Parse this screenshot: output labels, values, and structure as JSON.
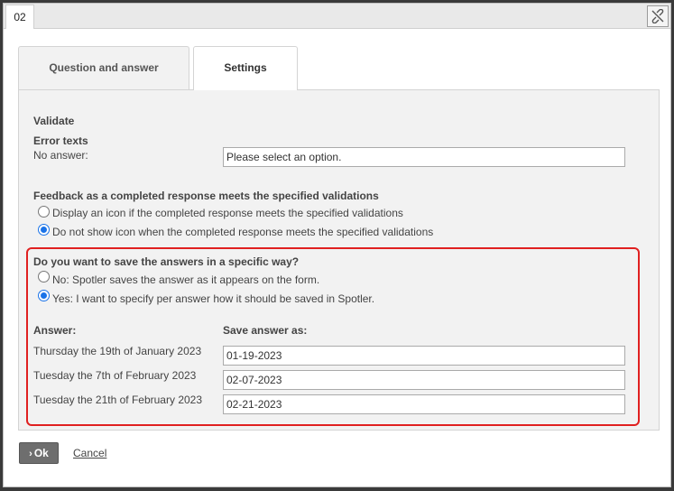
{
  "window": {
    "tab_label": "02"
  },
  "tabs": [
    {
      "label": "Question and answer"
    },
    {
      "label": "Settings"
    }
  ],
  "validate": {
    "heading": "Validate",
    "error_texts_label": "Error texts",
    "no_answer_label": "No answer:",
    "no_answer_value": "Please select an option."
  },
  "feedback": {
    "heading": "Feedback as a completed response meets the specified validations",
    "option_display": "Display an icon if the completed response meets the specified validations",
    "option_hide": "Do not show icon when the completed response meets the specified validations"
  },
  "save_answers": {
    "heading": "Do you want to save the answers in a specific way?",
    "option_no": "No: Spotler saves the answer as it appears on the form.",
    "option_yes": "Yes: I want to specify per answer how it should be saved in Spotler.",
    "col_answer": "Answer:",
    "col_save_as": "Save answer as:",
    "rows": [
      {
        "answer": "Thursday the 19th of January 2023",
        "save_as": "01-19-2023"
      },
      {
        "answer": "Tuesday the 7th of February 2023",
        "save_as": "02-07-2023"
      },
      {
        "answer": "Tuesday the 21th of February 2023",
        "save_as": "02-21-2023"
      }
    ]
  },
  "footer": {
    "ok_label": "Ok",
    "cancel_label": "Cancel"
  },
  "colors": {
    "highlight": "#e02020",
    "radio_accent": "#1a73e8"
  }
}
